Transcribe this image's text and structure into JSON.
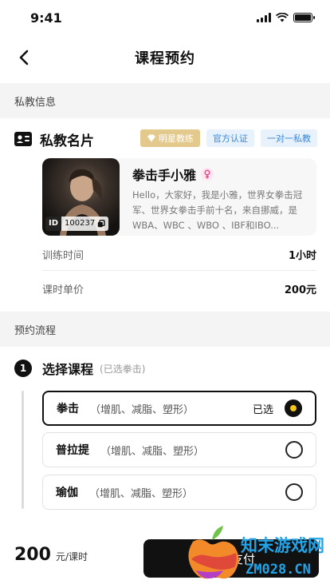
{
  "status_bar": {
    "time": "9:41"
  },
  "nav": {
    "title": "课程预约"
  },
  "section_coach": {
    "label": "私教信息"
  },
  "coach_card": {
    "title": "私教名片",
    "badges": [
      "明星教练",
      "官方认证",
      "一对一私教"
    ],
    "id_label": "ID",
    "id_number": "100237",
    "name": "拳击手小雅",
    "bio": "Hello，大家好，我是小雅，世界女拳击冠军、世界女拳击手前十名，来自挪威，是WBA、WBC 、WBO 、IBF和IBO..."
  },
  "training_info": [
    {
      "label": "训练时间",
      "value": "1小时"
    },
    {
      "label": "课时单价",
      "value": "200元"
    }
  ],
  "section_flow": {
    "label": "预约流程"
  },
  "step": {
    "number": "1",
    "title": "选择课程",
    "hint": "(已选拳击)"
  },
  "options": [
    {
      "name": "拳击",
      "desc": "（增肌、减脂、塑形）",
      "status": "已选",
      "selected": true
    },
    {
      "name": "普拉提",
      "desc": "（增肌、减脂、塑形）",
      "status": "",
      "selected": false
    },
    {
      "name": "瑜伽",
      "desc": "（增肌、减脂、塑形）",
      "status": "",
      "selected": false
    }
  ],
  "footer": {
    "price": "200",
    "unit": "元/课时",
    "pay_label": "确认支付"
  },
  "watermark": {
    "line1": "知末游戏网",
    "line2": "ZM028.CN"
  },
  "colors": {
    "accent": "#f5c518",
    "badge_gold": "#e4c98c",
    "badge_blue": "#3b86d6",
    "female_pink": "#e84a8a"
  }
}
